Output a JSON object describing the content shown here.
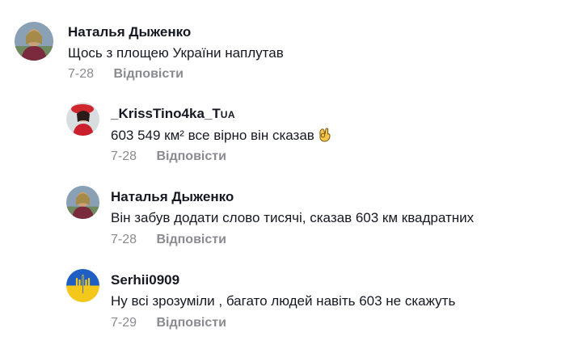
{
  "comments": [
    {
      "author": "Наталья Дыженко",
      "text": "Щось з площею України наплутав",
      "date": "7-28",
      "reply_label": "Відповісти"
    },
    {
      "author_main": "_KrissTino4ka_T",
      "author_suffix": "UA",
      "text": "603 549 км² все вірно він сказав",
      "emoji": "ok-hand-emoji",
      "date": "7-28",
      "reply_label": "Відповісти"
    },
    {
      "author": "Наталья Дыженко",
      "text": "Він забув додати слово тисячі, сказав 603 км квадратних",
      "date": "7-28",
      "reply_label": "Відповісти"
    },
    {
      "author": "Serhii0909",
      "text": "Ну всі зрозуміли , багато людей навіть 603 не скажуть",
      "date": "7-29",
      "reply_label": "Відповісти"
    }
  ],
  "colors": {
    "author": "#161823",
    "meta": "#8a8b91",
    "ua_blue": "#1f5fc4",
    "ua_yellow": "#f4c81a"
  }
}
